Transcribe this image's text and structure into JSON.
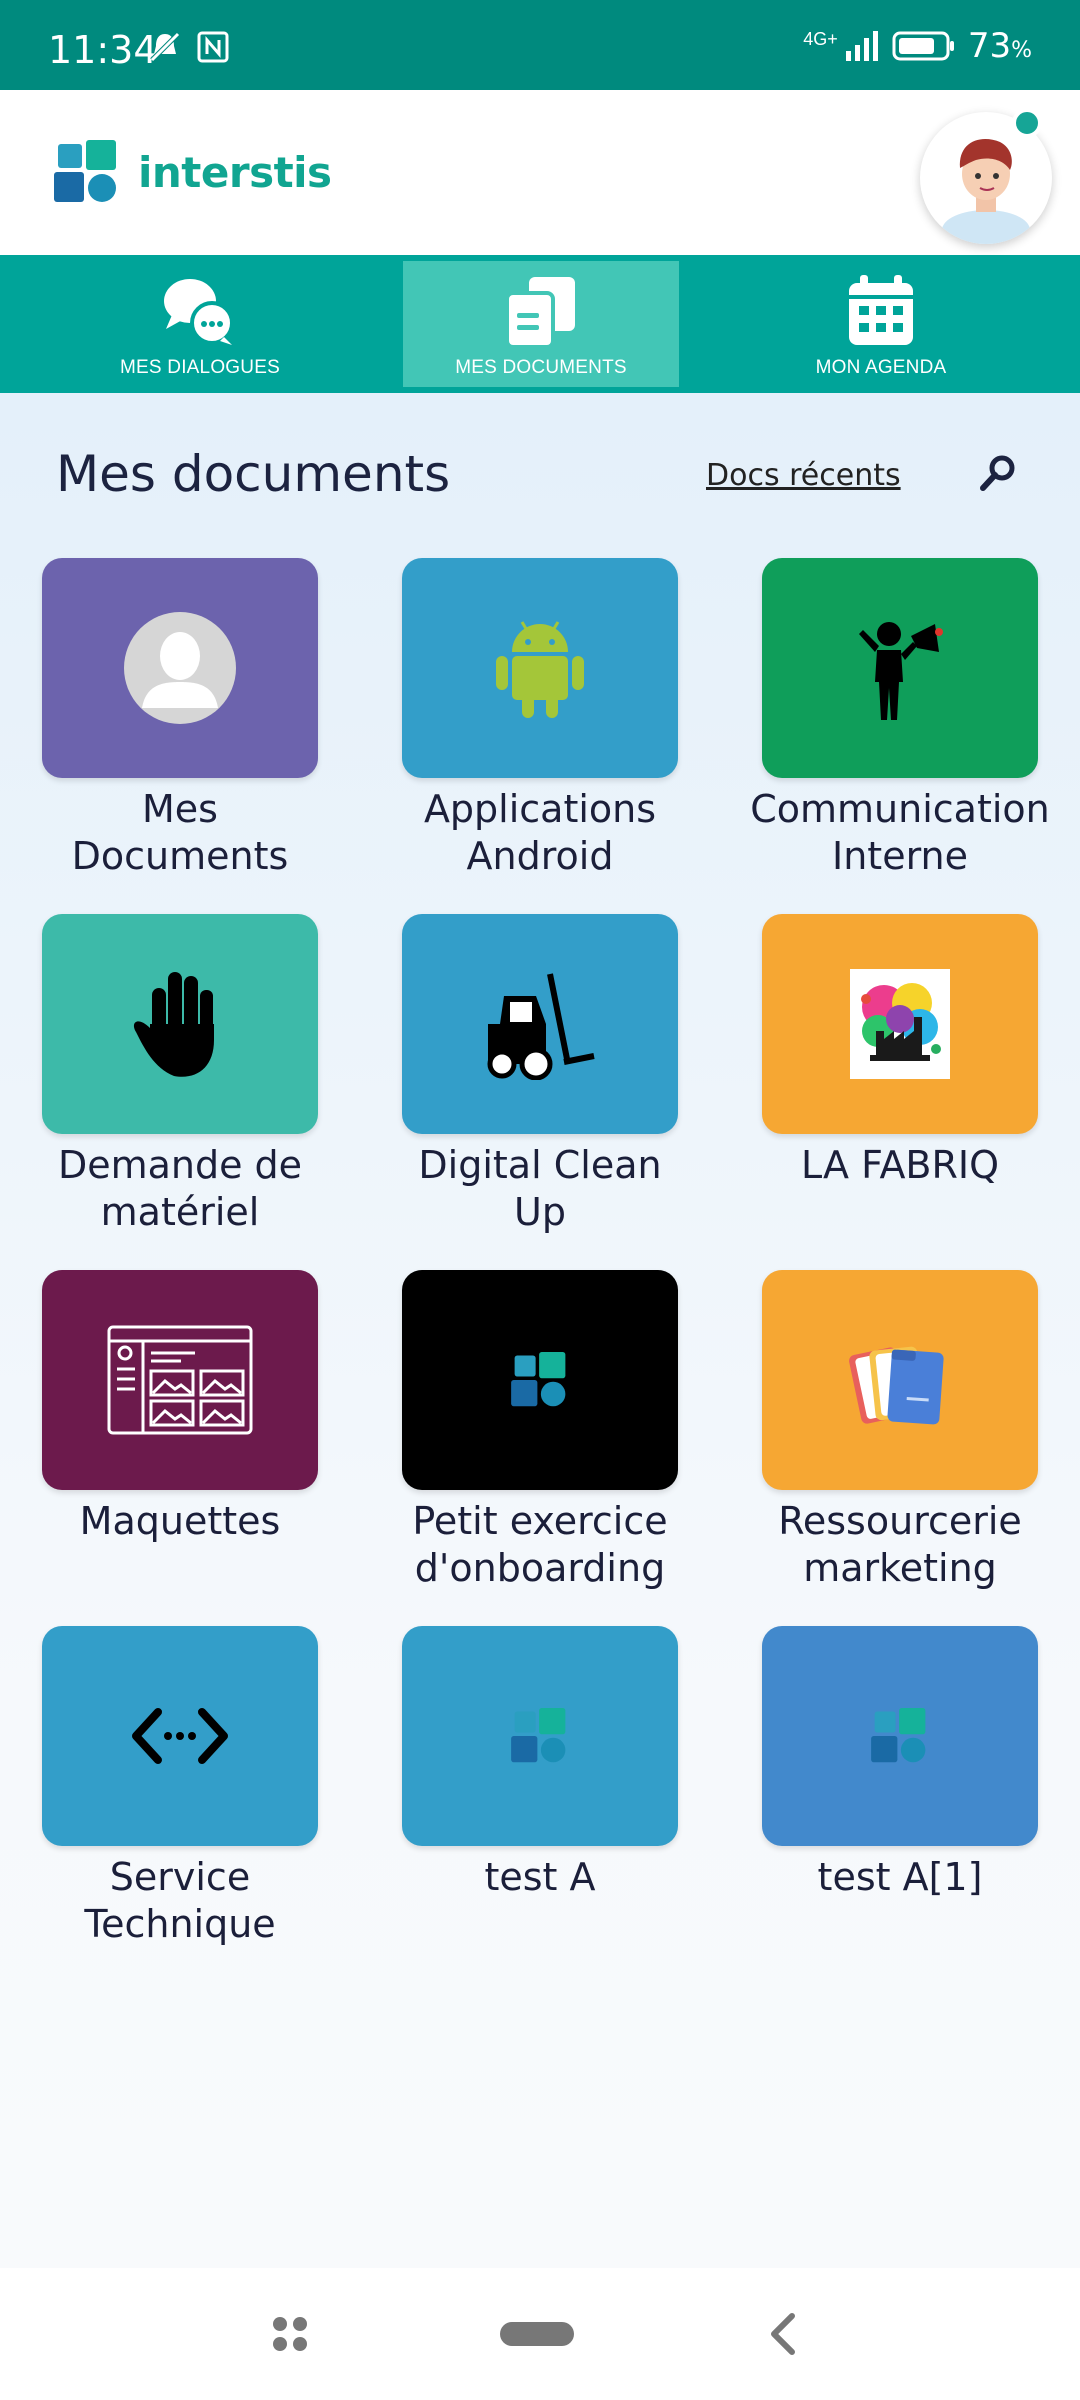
{
  "status_bar": {
    "time": "11:34",
    "network": "4G+",
    "battery": "73",
    "battery_unit": "%",
    "icons": [
      "mute-alarm-icon",
      "nfc-icon",
      "signal-icon",
      "battery-icon"
    ]
  },
  "app": {
    "name": "interstis",
    "brand_color": "#11a591"
  },
  "tabs": [
    {
      "label": "MES DIALOGUES",
      "icon": "chat-bubbles-icon",
      "active": false
    },
    {
      "label": "MES DOCUMENTS",
      "icon": "documents-icon",
      "active": true
    },
    {
      "label": "MON AGENDA",
      "icon": "calendar-icon",
      "active": false
    }
  ],
  "main": {
    "title": "Mes documents",
    "recent_link": "Docs récents",
    "search_icon": "search-icon"
  },
  "folders": [
    {
      "line1": "Mes",
      "line2": "Documents",
      "color": "#6c63ad",
      "icon": "user-placeholder-icon"
    },
    {
      "line1": "Applications",
      "line2": "Android",
      "color": "#339ec9",
      "icon": "android-icon"
    },
    {
      "line1": "Communication",
      "line2": "Interne",
      "color": "#0f9e5a",
      "icon": "megaphone-person-icon"
    },
    {
      "line1": "Demande de",
      "line2": "matériel",
      "color": "#3dbaa9",
      "icon": "hand-icon"
    },
    {
      "line1": "Digital Clean",
      "line2": "Up",
      "color": "#339ec9",
      "icon": "forklift-icon"
    },
    {
      "line1": "LA FABRIQ",
      "line2": "",
      "color": "#f6a733",
      "icon": "paint-splash-factory-icon"
    },
    {
      "line1": "Maquettes",
      "line2": "",
      "color": "#6c1a4c",
      "icon": "wireframe-icon"
    },
    {
      "line1": "Petit exercice",
      "line2": "d'onboarding",
      "color": "#000000",
      "icon": "interstis-logo-icon"
    },
    {
      "line1": "Ressourcerie",
      "line2": "marketing",
      "color": "#f6a733",
      "icon": "folders-icon"
    },
    {
      "line1": "Service",
      "line2": "Technique",
      "color": "#339ec9",
      "icon": "code-icon"
    },
    {
      "line1": "test A",
      "line2": "",
      "color": "#339ec9",
      "icon": "interstis-logo-icon"
    },
    {
      "line1": "test A[1]",
      "line2": "",
      "color": "#4289cc",
      "icon": "interstis-logo-icon"
    }
  ],
  "nav_bar": {
    "icons": [
      "recents-icon",
      "home-pill-icon",
      "back-icon"
    ]
  }
}
